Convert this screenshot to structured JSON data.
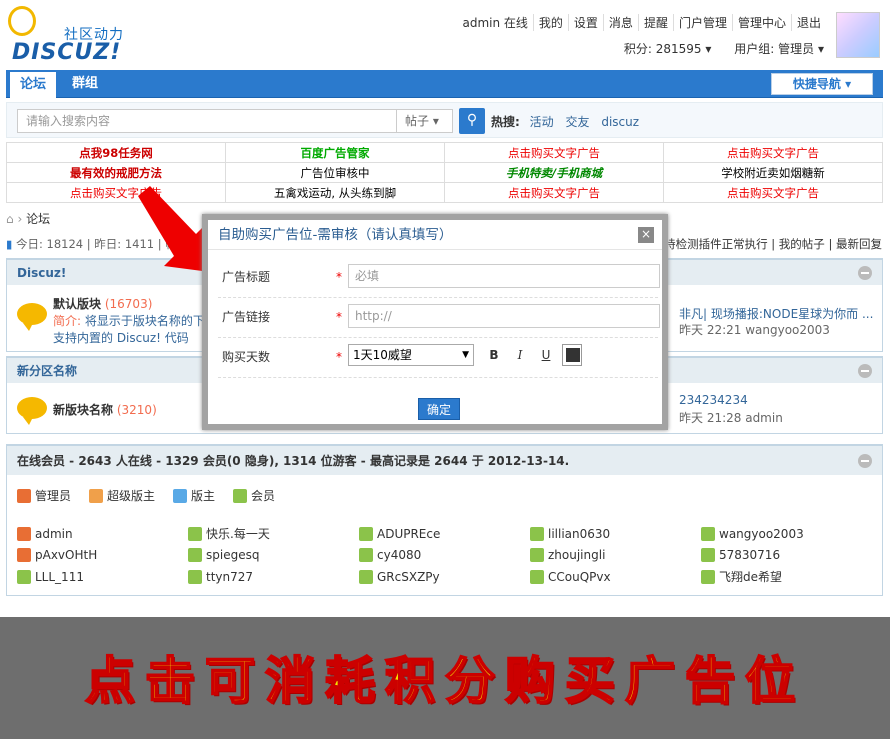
{
  "header": {
    "logo_cn": "社区动力",
    "logo_en": "DISCUZ!",
    "topbar": [
      "admin 在线",
      "我的",
      "设置",
      "消息",
      "提醒",
      "门户管理",
      "管理中心",
      "退出"
    ],
    "credits": "积分: 281595",
    "usergroup": "用户组: 管理员"
  },
  "nav": {
    "tabs": [
      "论坛",
      "群组"
    ],
    "quicknav": "快捷导航"
  },
  "search": {
    "placeholder": "请输入搜索内容",
    "scope": "帖子",
    "hot_label": "热搜:",
    "hot_terms": [
      "活动",
      "交友",
      "discuz"
    ]
  },
  "ads": [
    [
      "点我98任务网",
      "百度广告管家",
      "点击购买文字广告",
      "点击购买文字广告"
    ],
    [
      "最有效的戒肥方法",
      "广告位审核中",
      "手机特卖/手机商城",
      "学校附近卖如烟糖新"
    ],
    [
      "点击购买文字广告",
      "五禽戏运动, 从头练到脚",
      "点击购买文字广告",
      "点击购买文字广告"
    ]
  ],
  "breadcrumb": "论坛",
  "stats": {
    "left": "今日: 18124 | 昨日: 1411 | 帖子: 178",
    "right": "持检测插件正常执行 | 我的帖子 | 最新回复"
  },
  "forum_section1": {
    "title": "Discuz!",
    "forum_name": "默认版块",
    "forum_count": "(16703)",
    "desc_label": "简介:",
    "desc_text": "将显示于版块名称的下面",
    "desc_text2": "支持内置的 Discuz! 代码",
    "last_title": "非凡| 现场播报:NODE星球为你而 ...",
    "last_time": "昨天 22:21 wangyoo2003"
  },
  "forum_section2": {
    "title": "新分区名称",
    "forum_name": "新版块名称",
    "forum_count": "(3210)",
    "last_title": "234234234",
    "last_time": "昨天 21:28 admin"
  },
  "online": {
    "title": "在线会员 - 2643 人在线 - 1329 会员(0 隐身), 1314 位游客 - 最高记录是 2644 于 2012-13-14.",
    "legend": [
      "管理员",
      "超级版主",
      "版主",
      "会员"
    ],
    "members": [
      {
        "name": "admin",
        "icon": "admin"
      },
      {
        "name": "快乐.每一天",
        "icon": "mem"
      },
      {
        "name": "ADUPREce",
        "icon": "mem"
      },
      {
        "name": "lillian0630",
        "icon": "mem"
      },
      {
        "name": "wangyoo2003",
        "icon": "mem"
      },
      {
        "name": "pAxvOHtH",
        "icon": "admin"
      },
      {
        "name": "spiegesq",
        "icon": "mem"
      },
      {
        "name": "cy4080",
        "icon": "mem"
      },
      {
        "name": "zhoujingli",
        "icon": "mem"
      },
      {
        "name": "57830716",
        "icon": "mem"
      },
      {
        "name": "LLL_111",
        "icon": "mem"
      },
      {
        "name": "ttyn727",
        "icon": "mem"
      },
      {
        "name": "GRcSXZPy",
        "icon": "mem"
      },
      {
        "name": "CCouQPvx",
        "icon": "mem"
      },
      {
        "name": "飞翔de希望",
        "icon": "mem"
      }
    ]
  },
  "dialog": {
    "title": "自助购买广告位-需审核（请认真填写）",
    "close": "×",
    "title_label": "广告标题",
    "title_placeholder": "必填",
    "link_label": "广告链接",
    "link_placeholder": "http://",
    "days_label": "购买天数",
    "days_value": "1天10威望",
    "bold": "B",
    "italic": "I",
    "underline": "U",
    "ok": "确定"
  },
  "banner": "点击可消耗积分购买广告位",
  "colors": {
    "primary": "#2b7acd",
    "banner_bg": "#6e6e6e",
    "banner_text": "#f5e600"
  }
}
